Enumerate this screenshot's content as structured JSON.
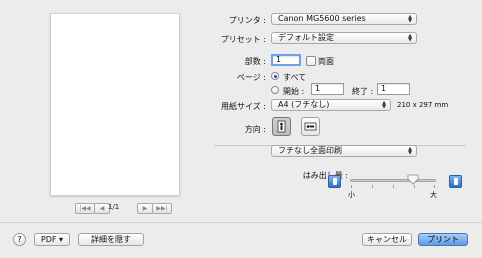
{
  "preview": {
    "page_indicator": "1/1",
    "nav_first": "|◀◀",
    "nav_prev": "◀",
    "nav_next": "▶",
    "nav_last": "▶▶|"
  },
  "form": {
    "printer_label": "プリンタ :",
    "printer_value": "Canon MG5600 series",
    "preset_label": "プリセット :",
    "preset_value": "デフォルト設定",
    "copies_label": "部数 :",
    "copies_value": "1",
    "duplex_label": "両面",
    "pages_label": "ページ :",
    "pages_all_label": "すべて",
    "pages_from_label": "開始 :",
    "pages_from_value": "1",
    "pages_to_label": "終了 :",
    "pages_to_value": "1",
    "paper_label": "用紙サイズ :",
    "paper_value": "A4 (フチなし)",
    "paper_dims": "210 x 297 mm",
    "orientation_label": "方向 :",
    "section_value": "フチなし全面印刷",
    "overhang_label": "はみ出し量 :",
    "overhang_small": "小",
    "overhang_large": "大",
    "overhang_level": 0.73
  },
  "footer": {
    "help_label": "?",
    "pdf_label": "PDF ▾",
    "details_label": "詳細を隠す",
    "cancel_label": "キャンセル",
    "print_label": "プリント"
  },
  "colors": {
    "default_button": "#5e9ae6",
    "focus_ring": "#6aa4e8"
  }
}
